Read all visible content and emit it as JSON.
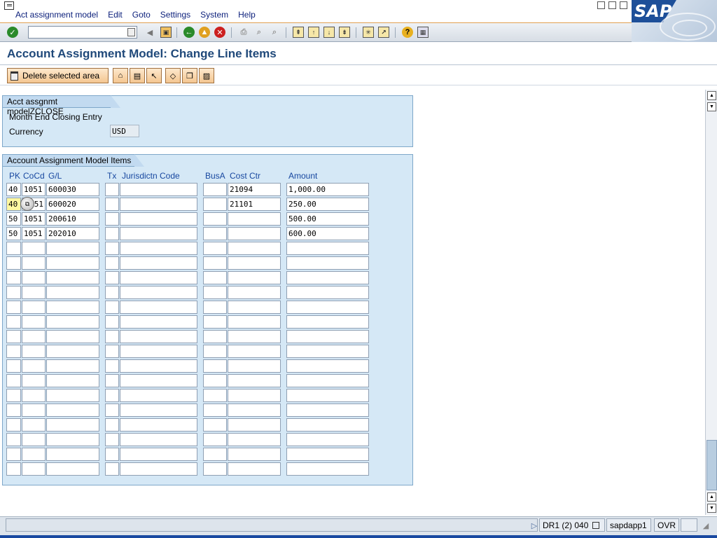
{
  "menu": {
    "items": [
      "Act assignment model",
      "Edit",
      "Goto",
      "Settings",
      "System",
      "Help"
    ]
  },
  "logo": {
    "text": "SAP"
  },
  "toolbar": {
    "command_value": ""
  },
  "title": "Account Assignment Model: Change Line Items",
  "app_toolbar": {
    "delete_label": "Delete selected area"
  },
  "header_group": {
    "title": "Acct assgnmt modelZCLOSE",
    "description": "Month End Closing Entry",
    "currency_label": "Currency",
    "currency_value": "USD"
  },
  "items_group": {
    "title": "Account Assignment Model Items",
    "columns": [
      "PK",
      "CoCd",
      "G/L",
      "Tx",
      "Jurisdictn Code",
      "BusA",
      "Cost Ctr",
      "Amount"
    ],
    "rows": [
      {
        "pk": "40",
        "cocd": "1051",
        "gl": "600030",
        "tx": "",
        "jur": "",
        "busa": "",
        "cc": "21094",
        "amt": "1,000.00"
      },
      {
        "pk": "40",
        "cocd": "51",
        "gl": "600020",
        "tx": "",
        "jur": "",
        "busa": "",
        "cc": "21101",
        "amt": "250.00"
      },
      {
        "pk": "50",
        "cocd": "1051",
        "gl": "200610",
        "tx": "",
        "jur": "",
        "busa": "",
        "cc": "",
        "amt": "500.00"
      },
      {
        "pk": "50",
        "cocd": "1051",
        "gl": "202010",
        "tx": "",
        "jur": "",
        "busa": "",
        "cc": "",
        "amt": "600.00"
      }
    ],
    "empty_rows": 16
  },
  "status": {
    "system": "DR1 (2) 040",
    "server": "sapdapp1",
    "mode": "OVR"
  },
  "colors": {
    "group_bg": "#d5e8f6",
    "title_color": "#20497a",
    "menu_color": "#0a1e7a",
    "header_color": "#1848a0"
  }
}
